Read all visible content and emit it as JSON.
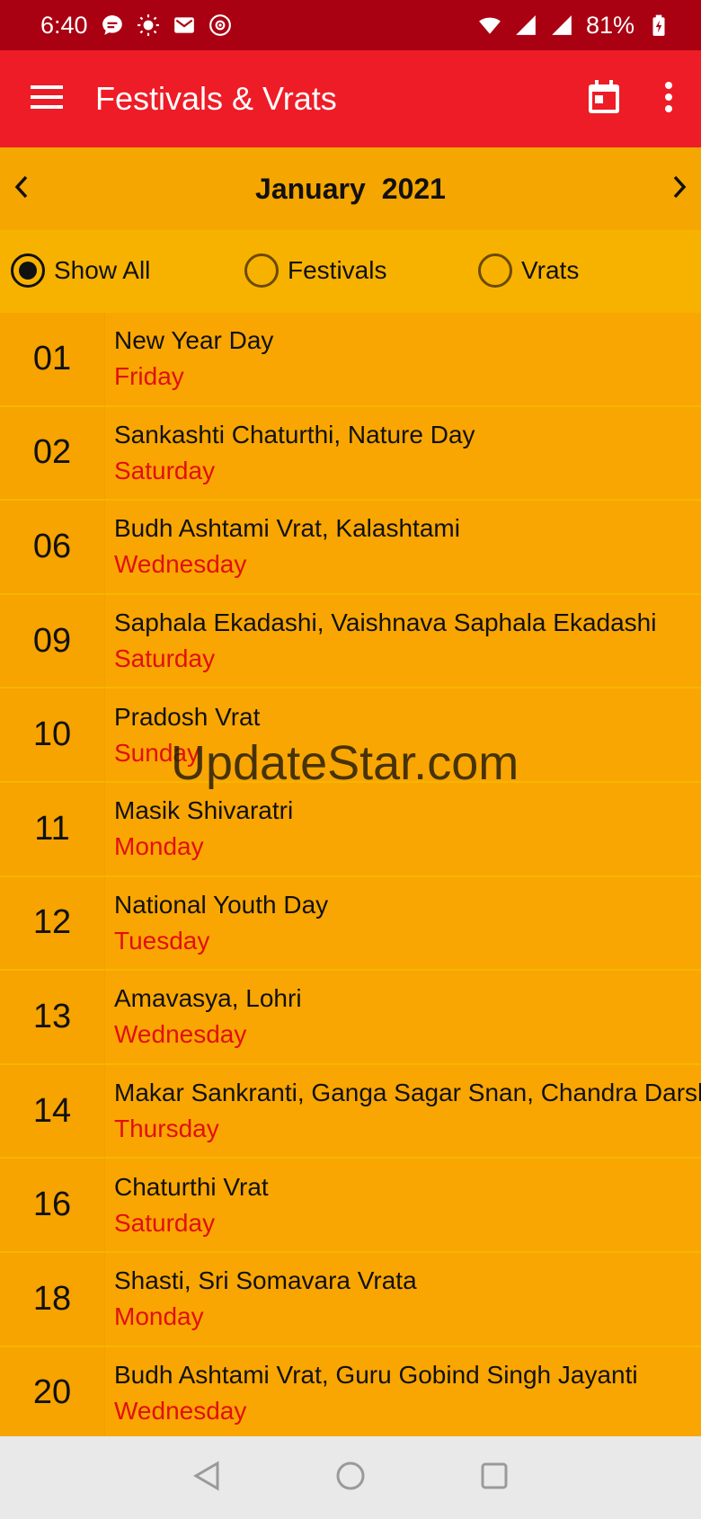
{
  "status_bar": {
    "time": "6:40",
    "battery": "81%",
    "icons": [
      "message-icon",
      "sun-icon",
      "gmail-icon",
      "music-icon",
      "wifi-icon",
      "signal-icon",
      "signal-icon",
      "battery-charging-icon"
    ]
  },
  "app_bar": {
    "title": "Festivals & Vrats",
    "icons": [
      "menu-icon",
      "calendar-icon",
      "more-vert-icon"
    ]
  },
  "month_nav": {
    "month": "January",
    "year": "2021"
  },
  "filters": {
    "options": [
      {
        "label": "Show All",
        "checked": true
      },
      {
        "label": "Festivals",
        "checked": false
      },
      {
        "label": "Vrats",
        "checked": false
      }
    ]
  },
  "events": [
    {
      "date": "01",
      "name": "New Year Day",
      "day": "Friday"
    },
    {
      "date": "02",
      "name": "Sankashti Chaturthi, Nature Day",
      "day": "Saturday"
    },
    {
      "date": "06",
      "name": "Budh Ashtami Vrat, Kalashtami",
      "day": "Wednesday"
    },
    {
      "date": "09",
      "name": "Saphala Ekadashi, Vaishnava Saphala Ekadashi",
      "day": "Saturday"
    },
    {
      "date": "10",
      "name": "Pradosh Vrat",
      "day": "Sunday"
    },
    {
      "date": "11",
      "name": "Masik Shivaratri",
      "day": "Monday"
    },
    {
      "date": "12",
      "name": "National Youth Day",
      "day": "Tuesday"
    },
    {
      "date": "13",
      "name": "Amavasya, Lohri",
      "day": "Wednesday"
    },
    {
      "date": "14",
      "name": "Makar Sankranti, Ganga Sagar Snan, Chandra Darshan",
      "day": "Thursday"
    },
    {
      "date": "16",
      "name": "Chaturthi Vrat",
      "day": "Saturday"
    },
    {
      "date": "18",
      "name": "Shasti, Sri Somavara Vrata",
      "day": "Monday"
    },
    {
      "date": "20",
      "name": "Budh Ashtami Vrat, Guru Gobind Singh Jayanti",
      "day": "Wednesday"
    }
  ],
  "watermark": "UpdateStar.com",
  "colors": {
    "status_bar": "#A90012",
    "app_bar": "#EE1C26",
    "list_bg": "#F9A602",
    "day_text": "#E01010"
  }
}
